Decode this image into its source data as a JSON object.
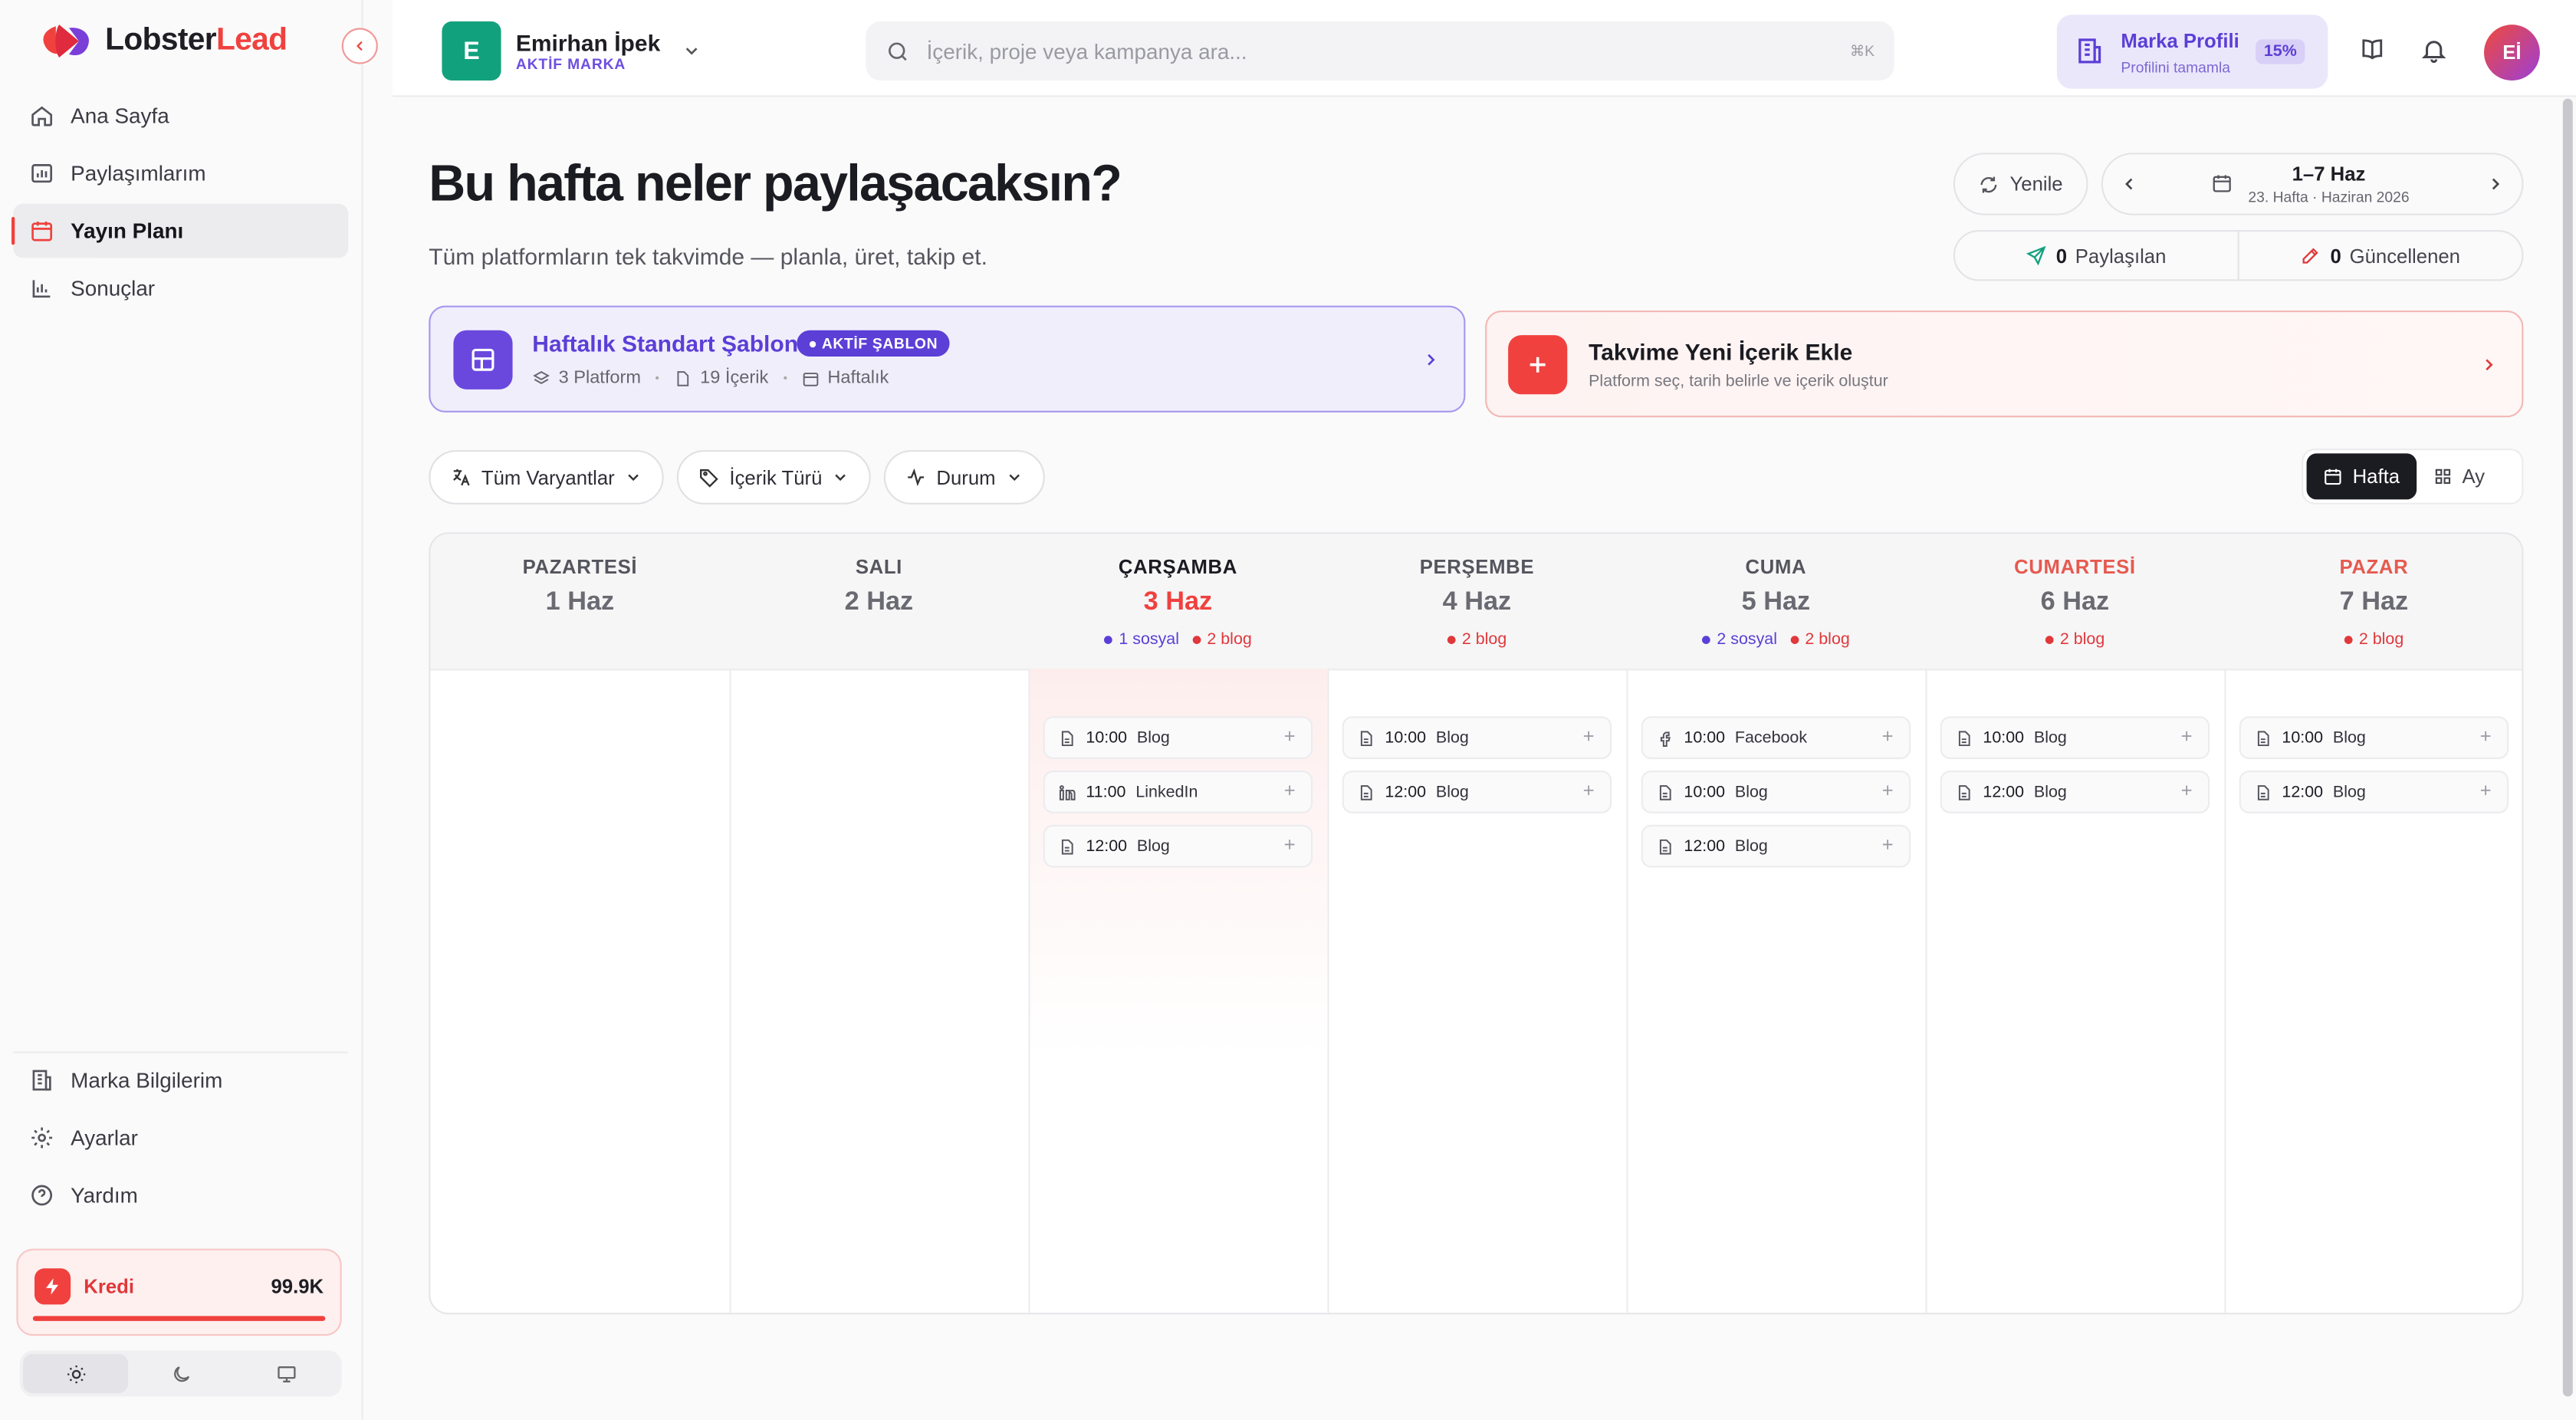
{
  "brand": {
    "logo_text_a": "Lobster",
    "logo_text_b": "Lead",
    "accent": "#f0413e",
    "accent_purple": "#5b3fd6"
  },
  "sidebar": {
    "items": [
      {
        "label": "Ana Sayfa",
        "icon": "home-icon"
      },
      {
        "label": "Paylaşımlarım",
        "icon": "chart-box-icon"
      },
      {
        "label": "Yayın Planı",
        "icon": "calendar-icon",
        "active": true
      },
      {
        "label": "Sonuçlar",
        "icon": "bar-chart-icon"
      }
    ],
    "bottom_items": [
      {
        "label": "Marka Bilgilerim",
        "icon": "building-icon"
      },
      {
        "label": "Ayarlar",
        "icon": "gear-icon"
      },
      {
        "label": "Yardım",
        "icon": "help-icon"
      }
    ],
    "credit": {
      "label": "Kredi",
      "value": "99.9K"
    }
  },
  "header": {
    "account": {
      "initial": "E",
      "name": "Emirhan İpek",
      "sub": "AKTİF MARKA"
    },
    "search": {
      "placeholder": "İçerik, proje veya kampanya ara...",
      "shortcut": "⌘K"
    },
    "profile": {
      "title": "Marka Profili",
      "sub": "Profilini tamamla",
      "percent": "15%"
    },
    "user_initials": "Eİ"
  },
  "main": {
    "title": "Bu hafta neler paylaşacaksın?",
    "subtitle": "Tüm platformların tek takvimde — planla, üret, takip et.",
    "refresh_label": "Yenile",
    "week": {
      "title": "1–7 Haz",
      "sub": "23. Hafta · Haziran 2026"
    },
    "stats": {
      "shared_count": "0",
      "shared_label": "Paylaşılan",
      "updated_count": "0",
      "updated_label": "Güncellenen"
    },
    "template": {
      "title": "Haftalık Standart Şablon",
      "badge": "AKTİF ŞABLON",
      "platforms": "3 Platform",
      "contents": "19 İçerik",
      "period": "Haftalık"
    },
    "add_new": {
      "title": "Takvime Yeni İçerik Ekle",
      "sub": "Platform seç, tarih belirle ve içerik oluştur"
    },
    "filters": {
      "variants": "Tüm Varyantlar",
      "type": "İçerik Türü",
      "status": "Durum"
    },
    "views": {
      "week": "Hafta",
      "month": "Ay"
    }
  },
  "calendar": {
    "days": [
      {
        "name": "PAZARTESİ",
        "date": "1 Haz",
        "tags": [],
        "events": []
      },
      {
        "name": "SALI",
        "date": "2 Haz",
        "tags": [],
        "events": []
      },
      {
        "name": "ÇARŞAMBA",
        "date": "3 Haz",
        "today": true,
        "tags": [
          {
            "kind": "social",
            "text": "1 sosyal"
          },
          {
            "kind": "blog",
            "text": "2 blog"
          }
        ],
        "events": [
          {
            "time": "10:00",
            "label": "Blog",
            "icon": "doc-icon"
          },
          {
            "time": "11:00",
            "label": "LinkedIn",
            "icon": "linkedin-icon"
          },
          {
            "time": "12:00",
            "label": "Blog",
            "icon": "doc-icon"
          }
        ]
      },
      {
        "name": "PERŞEMBE",
        "date": "4 Haz",
        "tags": [
          {
            "kind": "blog",
            "text": "2 blog"
          }
        ],
        "events": [
          {
            "time": "10:00",
            "label": "Blog",
            "icon": "doc-icon"
          },
          {
            "time": "12:00",
            "label": "Blog",
            "icon": "doc-icon"
          }
        ]
      },
      {
        "name": "CUMA",
        "date": "5 Haz",
        "tags": [
          {
            "kind": "social",
            "text": "2 sosyal"
          },
          {
            "kind": "blog",
            "text": "2 blog"
          }
        ],
        "events": [
          {
            "time": "10:00",
            "label": "Facebook",
            "icon": "facebook-icon"
          },
          {
            "time": "10:00",
            "label": "Blog",
            "icon": "doc-icon"
          },
          {
            "time": "12:00",
            "label": "Blog",
            "icon": "doc-icon"
          }
        ]
      },
      {
        "name": "CUMARTESİ",
        "date": "6 Haz",
        "weekend": true,
        "tags": [
          {
            "kind": "blog",
            "text": "2 blog"
          }
        ],
        "events": [
          {
            "time": "10:00",
            "label": "Blog",
            "icon": "doc-icon"
          },
          {
            "time": "12:00",
            "label": "Blog",
            "icon": "doc-icon"
          }
        ]
      },
      {
        "name": "PAZAR",
        "date": "7 Haz",
        "weekend": true,
        "tags": [
          {
            "kind": "blog",
            "text": "2 blog"
          }
        ],
        "events": [
          {
            "time": "10:00",
            "label": "Blog",
            "icon": "doc-icon"
          },
          {
            "time": "12:00",
            "label": "Blog",
            "icon": "doc-icon"
          }
        ]
      }
    ]
  }
}
